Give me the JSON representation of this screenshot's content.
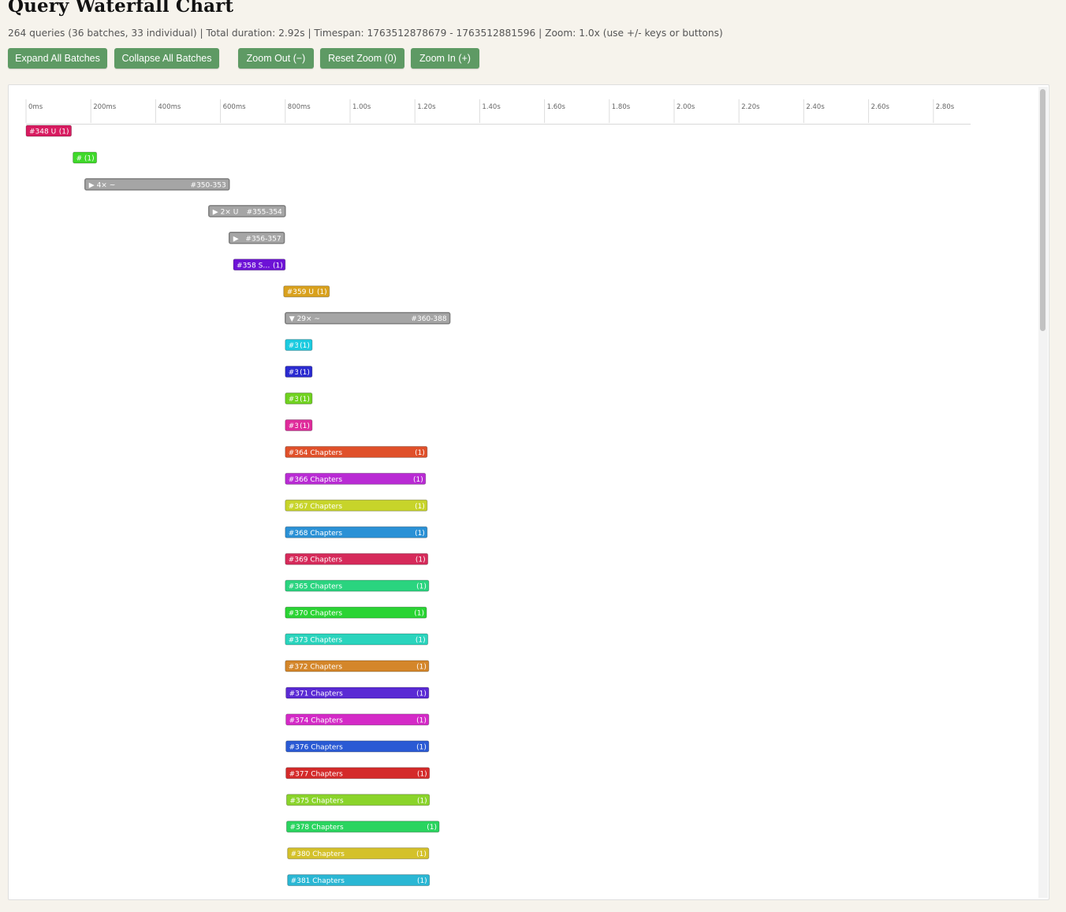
{
  "title": "Query Waterfall Chart",
  "info": "264 queries (36 batches, 33 individual) | Total duration: 2.92s | Timespan: 1763512878679 - 1763512881596 | Zoom: 1.0x (use +/- keys or buttons)",
  "buttons": {
    "expand_all": "Expand All Batches",
    "collapse_all": "Collapse All Batches",
    "zoom_out": "Zoom Out (−)",
    "reset_zoom": "Reset Zoom (0)",
    "zoom_in": "Zoom In (+)"
  },
  "chart_data": {
    "type": "waterfall",
    "x_unit": "ms",
    "x_range": [
      0,
      2920
    ],
    "ticks": [
      "0ms",
      "200ms",
      "400ms",
      "600ms",
      "800ms",
      "1.00s",
      "1.20s",
      "1.40s",
      "1.60s",
      "1.80s",
      "2.00s",
      "2.20s",
      "2.40s",
      "2.60s",
      "2.80s"
    ],
    "bars": [
      {
        "label": "#348 U",
        "count": "(1)",
        "start": 0,
        "end": 140,
        "color": "#d81b60"
      },
      {
        "label": "#",
        "count": "(1)",
        "start": 145,
        "end": 218,
        "color": "#3fd92a"
      },
      {
        "kind": "batch",
        "icon": "▶",
        "label": "4× ~",
        "range": "#350-353",
        "start": 182,
        "end": 627,
        "color": "#a5a5a5"
      },
      {
        "kind": "batch",
        "icon": "▶",
        "label": "2× U",
        "range": "#355-354",
        "start": 564,
        "end": 800,
        "color": "#a5a5a5"
      },
      {
        "kind": "batch",
        "icon": "▶",
        "label": "",
        "range": "#356-357",
        "start": 627,
        "end": 797,
        "color": "#a5a5a5"
      },
      {
        "label": "#358 S…",
        "count": "(1)",
        "start": 640,
        "end": 800,
        "color": "#6d12d6"
      },
      {
        "label": "#359 U",
        "count": "(1)",
        "start": 795,
        "end": 936,
        "color": "#d9a11d"
      },
      {
        "kind": "batch",
        "icon": "▼",
        "label": "29× ~",
        "range": "#360-388",
        "start": 800,
        "end": 1308,
        "color": "#a5a5a5"
      },
      {
        "label": "#3",
        "count": "(1)",
        "start": 800,
        "end": 883,
        "color": "#1ccbe0"
      },
      {
        "label": "#3",
        "count": "(1)",
        "start": 800,
        "end": 883,
        "color": "#2a2ad0"
      },
      {
        "label": "#3",
        "count": "(1)",
        "start": 800,
        "end": 883,
        "color": "#6fd11f"
      },
      {
        "label": "#3",
        "count": "(1)",
        "start": 800,
        "end": 883,
        "color": "#df2b9b"
      },
      {
        "label": "#364 Chapters",
        "count": "(1)",
        "start": 800,
        "end": 1238,
        "color": "#e0502a"
      },
      {
        "label": "#366 Chapters",
        "count": "(1)",
        "start": 800,
        "end": 1233,
        "color": "#b92bd4"
      },
      {
        "label": "#367 Chapters",
        "count": "(1)",
        "start": 800,
        "end": 1238,
        "color": "#c7d42a"
      },
      {
        "label": "#368 Chapters",
        "count": "(1)",
        "start": 800,
        "end": 1238,
        "color": "#2a91d6"
      },
      {
        "label": "#369 Chapters",
        "count": "(1)",
        "start": 800,
        "end": 1240,
        "color": "#d62a5a"
      },
      {
        "label": "#365 Chapters",
        "count": "(1)",
        "start": 800,
        "end": 1243,
        "color": "#2ad47f"
      },
      {
        "label": "#370 Chapters",
        "count": "(1)",
        "start": 800,
        "end": 1236,
        "color": "#2ad434"
      },
      {
        "label": "#373 Chapters",
        "count": "(1)",
        "start": 800,
        "end": 1240,
        "color": "#2ad4bd"
      },
      {
        "label": "#372 Chapters",
        "count": "(1)",
        "start": 800,
        "end": 1243,
        "color": "#d4862a"
      },
      {
        "label": "#371 Chapters",
        "count": "(1)",
        "start": 802,
        "end": 1243,
        "color": "#5a2ad4"
      },
      {
        "label": "#374 Chapters",
        "count": "(1)",
        "start": 802,
        "end": 1243,
        "color": "#d42ac7"
      },
      {
        "label": "#376 Chapters",
        "count": "(1)",
        "start": 802,
        "end": 1243,
        "color": "#2a5ad4"
      },
      {
        "label": "#377 Chapters",
        "count": "(1)",
        "start": 802,
        "end": 1245,
        "color": "#d42a2a"
      },
      {
        "label": "#375 Chapters",
        "count": "(1)",
        "start": 804,
        "end": 1245,
        "color": "#8ad42a"
      },
      {
        "label": "#378 Chapters",
        "count": "(1)",
        "start": 804,
        "end": 1275,
        "color": "#2ad45f"
      },
      {
        "label": "#380 Chapters",
        "count": "(1)",
        "start": 807,
        "end": 1243,
        "color": "#d4c12a"
      },
      {
        "label": "#381 Chapters",
        "count": "(1)",
        "start": 807,
        "end": 1245,
        "color": "#2ab7d4"
      }
    ]
  }
}
